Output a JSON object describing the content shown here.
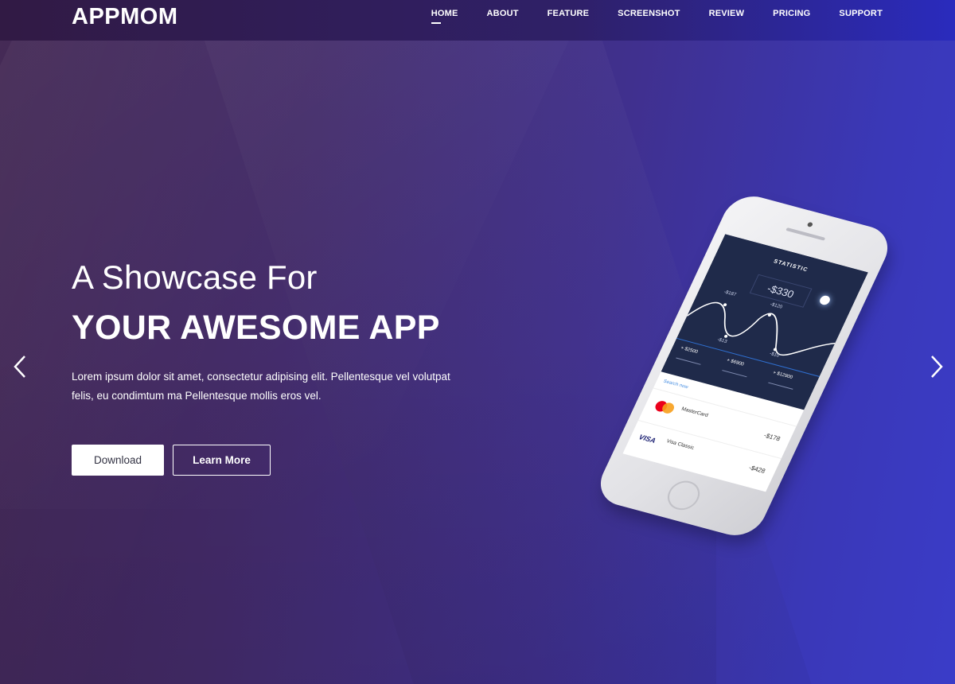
{
  "brand": {
    "name": "APPMOM"
  },
  "nav": {
    "items": [
      {
        "label": "HOME",
        "active": true
      },
      {
        "label": "ABOUT"
      },
      {
        "label": "FEATURE"
      },
      {
        "label": "SCREENSHOT"
      },
      {
        "label": "REVIEW"
      },
      {
        "label": "PRICING"
      },
      {
        "label": "SUPPORT"
      }
    ]
  },
  "hero": {
    "headline_line1": "A Showcase For",
    "headline_line2": "YOUR AWESOME APP",
    "description": "Lorem ipsum dolor sit amet, consectetur adipising elit. Pellentesque vel volutpat felis, eu condimtum ma Pellentesque mollis eros vel.",
    "download_label": "Download",
    "learn_more_label": "Learn More"
  },
  "phone": {
    "title": "STATISTIC",
    "balance": "-$330",
    "wave_labels": [
      "-$187",
      "-$120",
      "-$13",
      "-$10"
    ],
    "stats": [
      "+ $2500",
      "+ $6900",
      "+ $12900"
    ],
    "search_placeholder": "Search now",
    "cards": [
      {
        "name": "MasterCard",
        "amount": "-$178"
      },
      {
        "name": "Visa Classic",
        "amount": "-$428"
      }
    ]
  },
  "colors": {
    "nav_bg_start": "#311a44",
    "nav_bg_end": "#2a2bbd",
    "hero_bg_start": "#3f2450",
    "hero_bg_end": "#3a3cc8",
    "text": "#ffffff"
  },
  "icons": {
    "prev": "chevron-left-icon",
    "next": "chevron-right-icon"
  }
}
